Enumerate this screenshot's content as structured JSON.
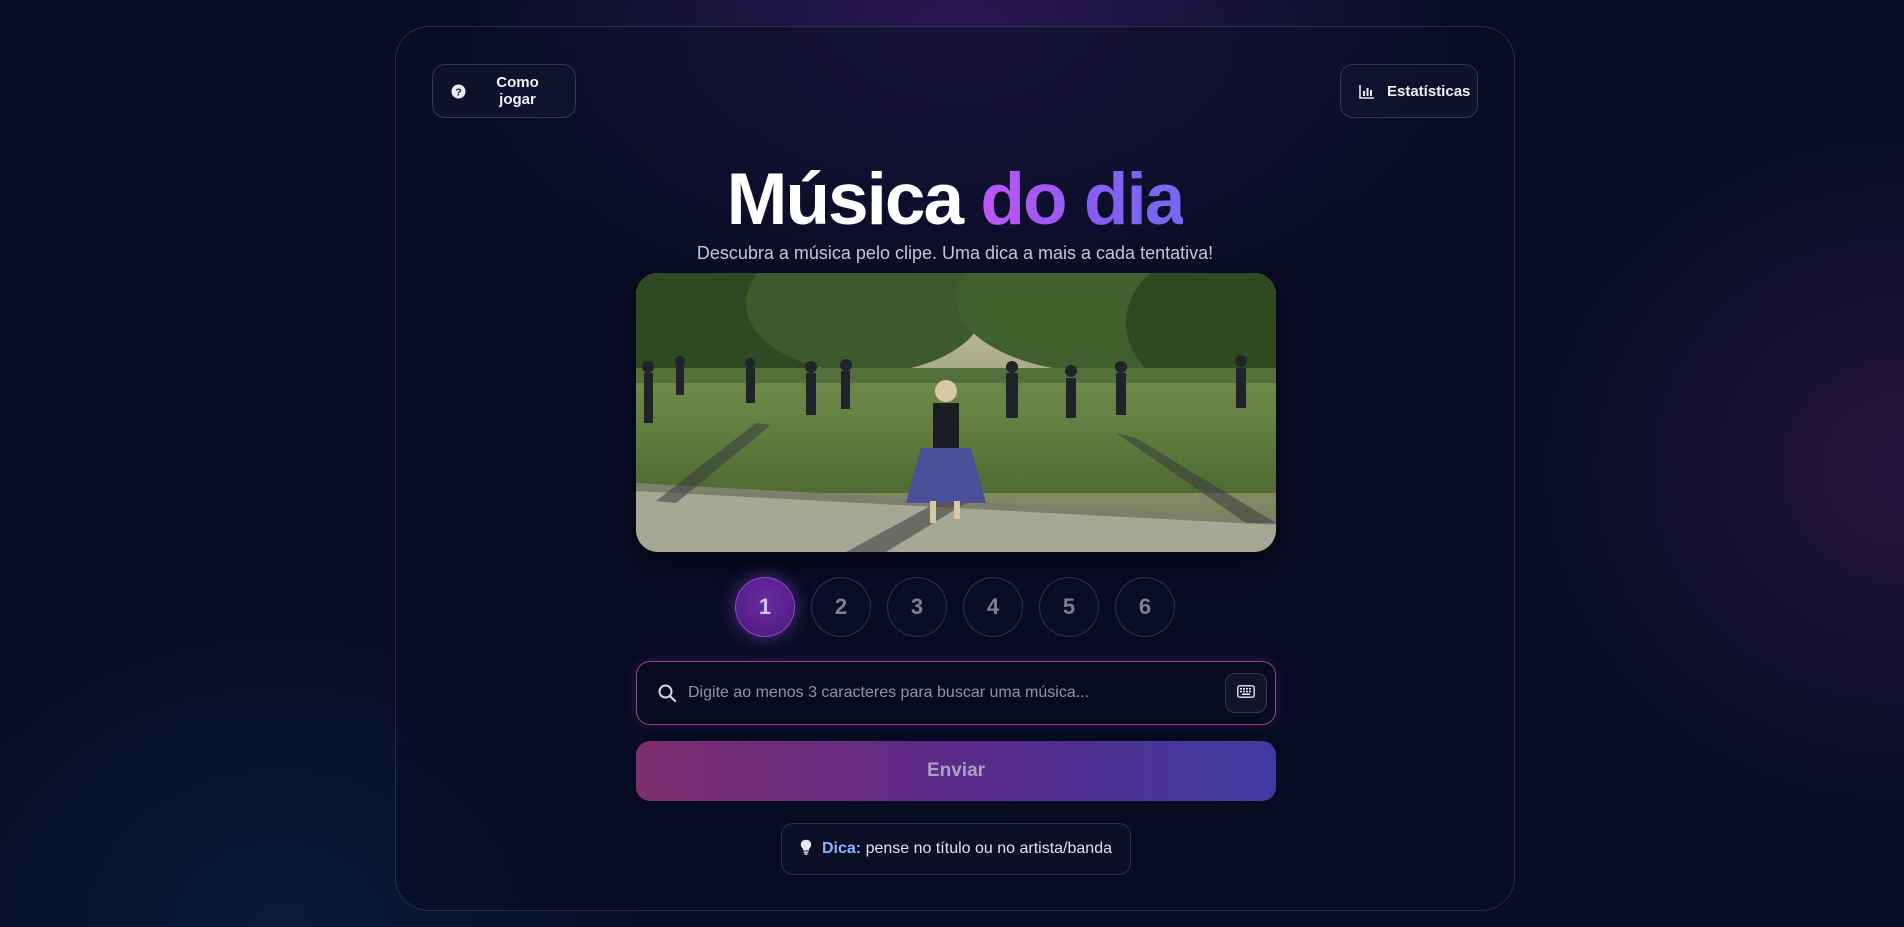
{
  "header": {
    "help_label": "Como jogar",
    "stats_label": "Estatísticas"
  },
  "hero": {
    "title_part1": "Música",
    "title_part2": "do dia",
    "subtitle": "Descubra a música pelo clipe. Uma dica a mais a cada tentativa!"
  },
  "attempts": {
    "items": [
      "1",
      "2",
      "3",
      "4",
      "5",
      "6"
    ],
    "current": 1
  },
  "search": {
    "placeholder": "Digite ao menos 3 caracteres para buscar uma música...",
    "value": ""
  },
  "submit": {
    "label": "Enviar"
  },
  "tip": {
    "label": "Dica:",
    "text": "pense no título ou no artista/banda"
  },
  "colors": {
    "accent_purple": "#8a5cf0",
    "accent_pink": "#c156f5",
    "tip_label": "#8cb4ff",
    "search_border": "#9a3f9a"
  }
}
